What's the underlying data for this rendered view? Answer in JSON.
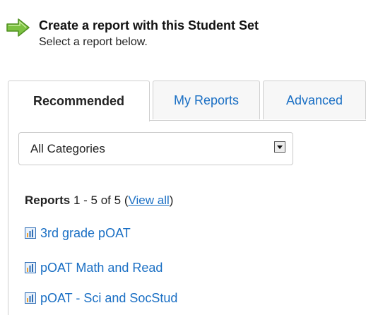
{
  "header": {
    "title": "Create a report with this Student Set",
    "subtitle": "Select a report below."
  },
  "tabs": [
    {
      "label": "Recommended",
      "active": true
    },
    {
      "label": "My Reports",
      "active": false
    },
    {
      "label": "Advanced",
      "active": false
    }
  ],
  "filter": {
    "selected": "All Categories"
  },
  "reports_summary": {
    "label": "Reports",
    "range": "1 - 5 of 5",
    "open_paren": "(",
    "view_all": "View all",
    "close_paren": ")"
  },
  "reports": [
    {
      "label": "3rd grade pOAT",
      "icon": "bar-chart-icon"
    },
    {
      "label": "pOAT Math and Read",
      "icon": "bar-chart-icon"
    },
    {
      "label": "pOAT - Sci and SocStud",
      "icon": "bar-chart-icon"
    }
  ],
  "colors": {
    "link": "#1a6fc4",
    "arrow_green": "#7dc242",
    "chart_bar_blue": "#2f6db5",
    "chart_bar_orange": "#f0a030"
  }
}
